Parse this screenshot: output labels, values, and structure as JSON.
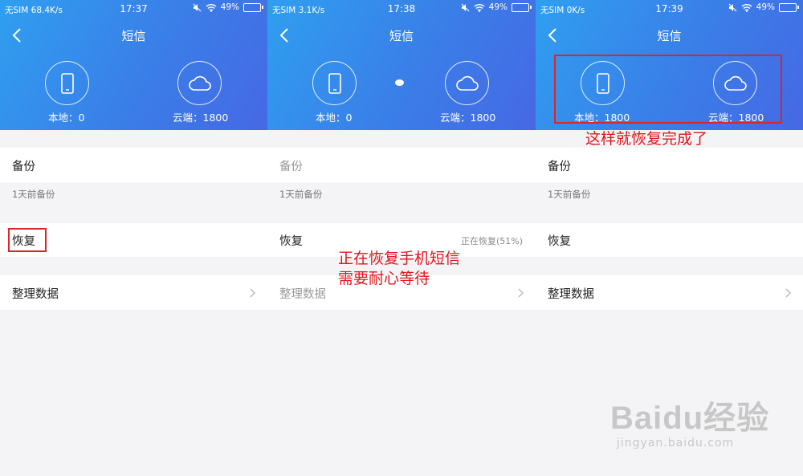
{
  "screens": [
    {
      "status": {
        "left": "无SIM 68.4K/s",
        "time": "17:37",
        "battery": "49%"
      },
      "title": "短信",
      "local_label": "本地：0",
      "cloud_label": "云端：1800",
      "backup_title": "备份",
      "backup_sub": "1天前备份",
      "restore_title": "恢复",
      "restore_status": "",
      "organize_title": "整理数据"
    },
    {
      "status": {
        "left": "无SIM 3.1K/s",
        "time": "17:38",
        "battery": "49%"
      },
      "title": "短信",
      "local_label": "本地：0",
      "cloud_label": "云端：1800",
      "backup_title": "备份",
      "backup_sub": "1天前备份",
      "restore_title": "恢复",
      "restore_status": "正在恢复(51%)",
      "organize_title": "整理数据"
    },
    {
      "status": {
        "left": "无SIM 0K/s",
        "time": "17:39",
        "battery": "49%"
      },
      "title": "短信",
      "local_label": "本地：1800",
      "cloud_label": "云端：1800",
      "backup_title": "备份",
      "backup_sub": "1天前备份",
      "restore_title": "恢复",
      "restore_status": "",
      "organize_title": "整理数据"
    }
  ],
  "annotations": {
    "middle_line1": "正在恢复手机短信",
    "middle_line2": "需要耐心等待",
    "right": "这样就恢复完成了"
  },
  "watermark": {
    "main": "Baidu经验",
    "sub": "jingyan.baidu.com"
  },
  "colors": {
    "header_start": "#2f9ff0",
    "header_end": "#4668e4",
    "annotation": "#e0151d"
  },
  "icons": [
    "back-arrow-icon",
    "phone-icon",
    "cloud-icon",
    "wifi-icon",
    "mute-icon",
    "battery-icon",
    "chevron-right-icon"
  ]
}
